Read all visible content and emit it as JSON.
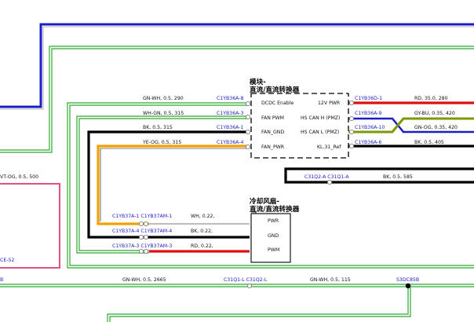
{
  "colors": {
    "blue": "#1c1cc8",
    "green": "#2ea82e",
    "black": "#000000",
    "red": "#e01010",
    "orange": "#f0a000",
    "gray": "#9a9a9a",
    "pink": "#e0508a",
    "pin": "#1e1ec8"
  },
  "dcdc": {
    "title_line1": "模块-",
    "title_line2": "直流/直流转换器",
    "left_pins": [
      "DCDC Enable",
      "FAN PWM",
      "FAN_GND",
      "FAN_PWR"
    ],
    "right_pins": [
      "12V PWR",
      "HS CAN H (PMZ)",
      "HS CAN L (PMZ)",
      "KL.31_Ref"
    ]
  },
  "fan": {
    "title_line1": "冷却风扇-",
    "title_line2": "直流/直流转换器",
    "pins": [
      "PWR",
      "GND",
      "PWM"
    ]
  },
  "wires": {
    "w1": "GN-WH, 0.5, 290",
    "w2": "WH-GN, 0.5, 315",
    "w3": "BK, 0.5, 315",
    "w4": "YE-OG, 0.5, 315",
    "r1": "RD, 35.0, 280",
    "r2": "GY-BU, 0.35, 420",
    "r3": "GN-OG, 0.35, 420",
    "r4": "BK, 0.5, 405",
    "mid": "BK, 0.5, 585",
    "f1": "WH, 0.22,",
    "f2": "BK, 0.22,",
    "f3": "RD, 0.22,",
    "b1": "GN-WH, 0.5, 2665",
    "b2": "GN-WH, 0.5, 115",
    "vt": "VT-OG, 0.5, 500"
  },
  "connectors": {
    "c1": "C1YB36A-8",
    "c2": "C1YB36A-3",
    "c3": "C1YB36A-1",
    "c4": "C1YB36A-4",
    "r1": "C1YB36D-1",
    "r2": "C1YB36A-9",
    "r3": "C1YB36A-10",
    "r4": "C1YB36A-6",
    "mid": "C31Q2-A  C31Q1-A",
    "f1": "C1YB37A-1  C1YB37AM-1",
    "f2": "C1YB37A-4  C1YB37AM-4",
    "f3": "C1YB37A-3  C1YB37AM-3",
    "b1": "C31Q1-L  C31Q2-L",
    "b2": "S3DC85B",
    "left_b": "B",
    "left_e": "CE-52"
  }
}
